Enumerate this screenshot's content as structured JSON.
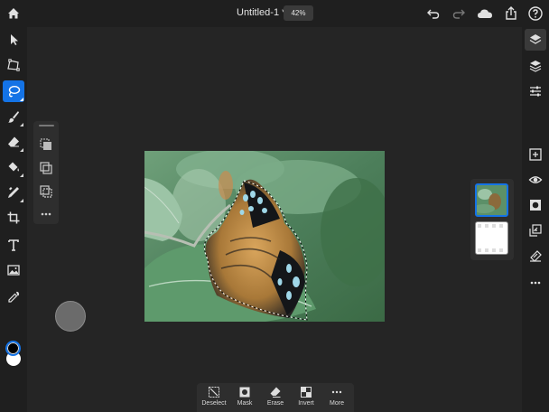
{
  "document": {
    "title": "Untitled-1 *",
    "zoom": "42%"
  },
  "taskbar": {
    "deselect": "Deselect",
    "mask": "Mask",
    "erase": "Erase",
    "invert": "Invert",
    "more": "More"
  },
  "colors": {
    "accent": "#1473e6",
    "toolbar_bg": "#1f1f1f",
    "workspace_bg": "#252525",
    "foreground_color": "#000000",
    "background_color": "#ffffff"
  },
  "left_toolbar": {
    "tools": [
      "select-tool",
      "transform-tool",
      "lasso-select-tool",
      "brush-tool",
      "eraser-tool",
      "fill-tool",
      "healing-brush-tool",
      "crop-tool",
      "type-tool",
      "place-image-tool",
      "eyedropper-tool"
    ],
    "active_tool": "lasso-select-tool"
  },
  "right_toolbar": {
    "tools": [
      "layers-icon",
      "layer-properties-icon",
      "adjustments-icon",
      "add-layer-icon",
      "visibility-icon",
      "mask-icon",
      "arrange-icon",
      "clip-icon",
      "more-icon"
    ]
  }
}
